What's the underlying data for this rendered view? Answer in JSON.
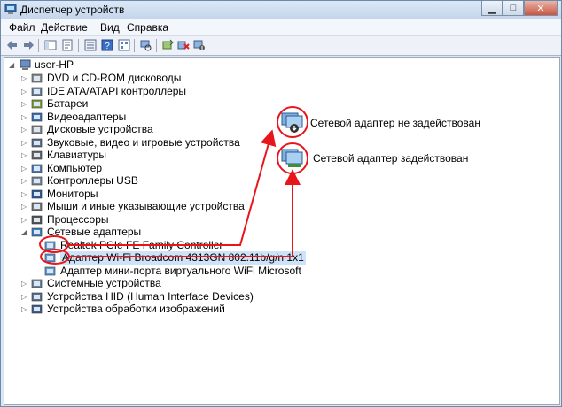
{
  "window": {
    "title": "Диспетчер устройств"
  },
  "menu": [
    "Файл",
    "Действие",
    "Вид",
    "Справка"
  ],
  "tree": {
    "root": "user-HP",
    "categories": [
      "DVD и CD-ROM дисководы",
      "IDE ATA/ATAPI контроллеры",
      "Батареи",
      "Видеоадаптеры",
      "Дисковые устройства",
      "Звуковые, видео и игровые устройства",
      "Клавиатуры",
      "Компьютер",
      "Контроллеры USB",
      "Мониторы",
      "Мыши и иные указывающие устройства",
      "Процессоры",
      "Сетевые адаптеры"
    ],
    "network_adapters": [
      "Realtek PCIe FE Family Controller",
      "Адаптер Wi-Fi Broadcom 4313GN 802.11b/g/n 1x1",
      "Адаптер мини-порта виртуального WiFi Microsoft"
    ],
    "categories_after": [
      "Системные устройства",
      "Устройства HID (Human Interface Devices)",
      "Устройства обработки изображений"
    ]
  },
  "legend": {
    "disabled": "Сетевой адаптер не задействован",
    "enabled": "Сетевой адаптер задействован"
  },
  "colors": {
    "annotation": "#e8161b",
    "highlight_bg": "#cfe3f8"
  }
}
